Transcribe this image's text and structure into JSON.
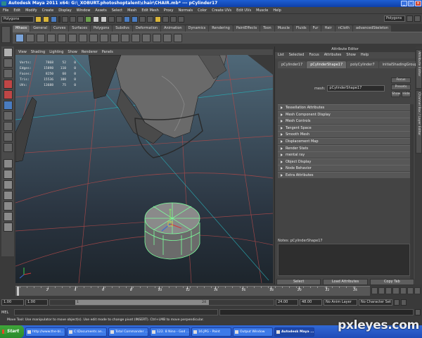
{
  "window": {
    "title": "Autodesk Maya 2011 x64: G:\\_XOBURT.photoshoptalent\\chair\\CHAIR.mb* --- pCylinder17"
  },
  "menubar": [
    "File",
    "Edit",
    "Modify",
    "Create",
    "Display",
    "Window",
    "Assets",
    "Select",
    "Mesh",
    "Edit Mesh",
    "Proxy",
    "Normals",
    "Color",
    "Create UVs",
    "Edit UVs",
    "Muscle",
    "Help"
  ],
  "statusline": {
    "mode": "Polygons",
    "right_field": "Polygons"
  },
  "shelf": {
    "tabs": [
      "Mhaos",
      "General",
      "Curves",
      "Surfaces",
      "Polygons",
      "Subdivs",
      "Deformation",
      "Animation",
      "Dynamics",
      "Rendering",
      "PaintEffects",
      "Toon",
      "Muscle",
      "Fluids",
      "Fur",
      "Hair",
      "nCloth",
      "advancedSkeleton"
    ],
    "active_tab": 0
  },
  "viewport": {
    "menu": [
      "View",
      "Shading",
      "Lighting",
      "Show",
      "Renderer",
      "Panels"
    ],
    "hud": [
      {
        "key": "Verts:",
        "v1": "7868",
        "v2": "52",
        "v3": "0"
      },
      {
        "key": "Edges:",
        "v1": "15898",
        "v2": "110",
        "v3": "0"
      },
      {
        "key": "Faces:",
        "v1": "8250",
        "v2": "60",
        "v3": "0"
      },
      {
        "key": "Tris:",
        "v1": "15536",
        "v2": "100",
        "v3": "0"
      },
      {
        "key": "UVs:",
        "v1": "13688",
        "v2": "75",
        "v3": "0"
      }
    ]
  },
  "attribute_editor": {
    "title": "Attribute Editor",
    "menu": [
      "List",
      "Selected",
      "Focus",
      "Attributes",
      "Show",
      "Help"
    ],
    "tabs": [
      "pCylinder17",
      "pCylinderShape17",
      "polyCylinder7",
      "initialShadingGroup"
    ],
    "active_tab": 1,
    "mesh_label": "mesh:",
    "mesh_value": "pCylinderShape17",
    "side_buttons": {
      "focus": "Focus",
      "presets": "Presets",
      "show": "Show",
      "hide": "Hide"
    },
    "sections": [
      "Tessellation Attributes",
      "Mesh Component Display",
      "Mesh Controls",
      "Tangent Space",
      "Smooth Mesh",
      "Displacement Map",
      "Render Stats",
      "mental ray",
      "Object Display",
      "Node Behavior",
      "Extra Attributes"
    ],
    "notes_label": "Notes: pCylinderShape17",
    "bottom_buttons": [
      "Select",
      "Load Attributes",
      "Copy Tab"
    ]
  },
  "side_tabs": [
    "Attribute Editor",
    "Channel Box / Layer Editor"
  ],
  "timeline": {
    "labels": [
      "2",
      "4",
      "6",
      "8",
      "10",
      "12",
      "14",
      "16",
      "18",
      "20",
      "22",
      "24"
    ]
  },
  "range": {
    "start": "1.00",
    "start2": "1.00",
    "inner_start": "1",
    "inner_end": "24",
    "end": "24.00",
    "end2": "48.00",
    "anim_layer": "No Anim Layer",
    "character": "No Character Set"
  },
  "cmdline": {
    "label": "MEL"
  },
  "helpline": "Move Tool: Use manipulator to move object(s). Use edit mode to change pivot (INSERT). Ctrl+LMB to move perpendicular.",
  "taskbar": {
    "start": "Start",
    "tasks": [
      "http://www.the-bl...",
      "C:\\Documents an...",
      "Total Commander ...",
      "122. 8 Nino - God ...",
      "16.JPG - Paint",
      "Output Window",
      "Autodesk Maya ..."
    ],
    "active_task": 6
  },
  "watermark": "pxleyes.com"
}
